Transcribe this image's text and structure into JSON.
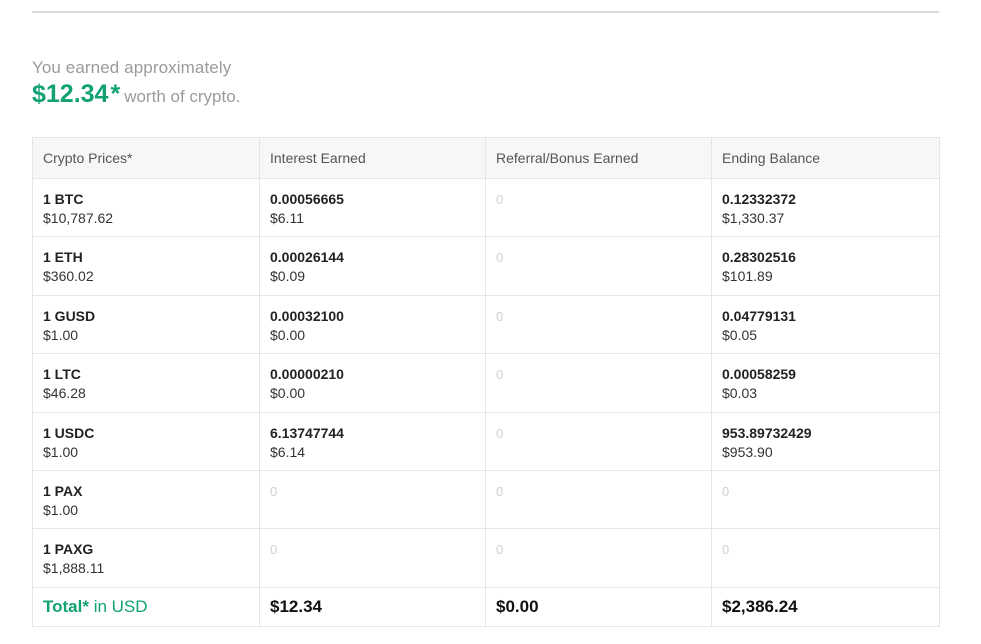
{
  "summary": {
    "intro": "You earned approximately",
    "amount": "$12.34",
    "star": "*",
    "worth": "worth of crypto."
  },
  "table": {
    "headers": [
      "Crypto Prices*",
      "Interest Earned",
      "Referral/Bonus Earned",
      "Ending Balance"
    ],
    "rows": [
      {
        "coin": "1 BTC",
        "price": "$10,787.62",
        "interest_amount": "0.00056665",
        "interest_usd": "$6.11",
        "referral": "0",
        "balance_amount": "0.12332372",
        "balance_usd": "$1,330.37"
      },
      {
        "coin": "1 ETH",
        "price": "$360.02",
        "interest_amount": "0.00026144",
        "interest_usd": "$0.09",
        "referral": "0",
        "balance_amount": "0.28302516",
        "balance_usd": "$101.89"
      },
      {
        "coin": "1 GUSD",
        "price": "$1.00",
        "interest_amount": "0.00032100",
        "interest_usd": "$0.00",
        "referral": "0",
        "balance_amount": "0.04779131",
        "balance_usd": "$0.05"
      },
      {
        "coin": "1 LTC",
        "price": "$46.28",
        "interest_amount": "0.00000210",
        "interest_usd": "$0.00",
        "referral": "0",
        "balance_amount": "0.00058259",
        "balance_usd": "$0.03"
      },
      {
        "coin": "1 USDC",
        "price": "$1.00",
        "interest_amount": "6.13747744",
        "interest_usd": "$6.14",
        "referral": "0",
        "balance_amount": "953.89732429",
        "balance_usd": "$953.90"
      },
      {
        "coin": "1 PAX",
        "price": "$1.00",
        "interest_zero": "0",
        "referral": "0",
        "balance_zero": "0"
      },
      {
        "coin": "1 PAXG",
        "price": "$1,888.11",
        "interest_zero": "0",
        "referral": "0",
        "balance_zero": "0"
      }
    ],
    "total": {
      "label_bold": "Total*",
      "label_rest": " in USD",
      "interest": "$12.34",
      "referral": "$0.00",
      "balance": "$2,386.24"
    }
  },
  "colors": {
    "accent_green": "#10a174",
    "muted_text": "#9b9b9b",
    "header_bg": "#f7f7f7",
    "border": "#e6e6e6"
  }
}
